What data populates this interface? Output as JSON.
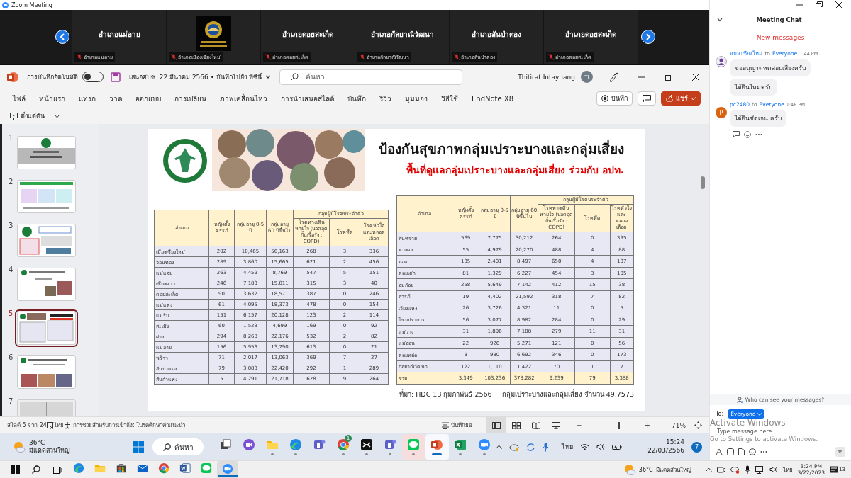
{
  "zoom_window": {
    "title": "Zoom Meeting"
  },
  "video_tiles": [
    {
      "kind": "name",
      "name": "อำเภอแม่อาย",
      "label": "อำเภอแม่อาย",
      "muted": true
    },
    {
      "kind": "picture",
      "label": "อำเภอเมืองเชียงใหม่",
      "muted": true
    },
    {
      "kind": "name",
      "name": "อำเภอดอยสะเก็ด",
      "label": "อำเภอดอยสะเก็ด",
      "muted": true
    },
    {
      "kind": "name",
      "name": "อำเภอกัลยาณิวัฒนา",
      "label": "อำเภอกัลยาณิวัฒนา",
      "muted": true
    },
    {
      "kind": "name",
      "name": "อำเภอสันป่าตอง",
      "label": "อำเภอสันป่าตอง",
      "muted": true
    },
    {
      "kind": "name",
      "name": "อำเภอดอยสะเก็ด",
      "label": "อำเภอดอยสะเก็ด",
      "muted": true
    }
  ],
  "powerpoint": {
    "autosave_label": "การบันทึกอัตโนมัติ",
    "autosave_on": false,
    "file_title": "เสนอศบซ. 22 มีนาคม 2566 • บันทึกไปยัง พีซีนี้",
    "search_placeholder": "ค้นหา",
    "user_name": "Thitirat Intayuang",
    "user_initials": "TI",
    "ribbon_tabs": [
      "ไฟล์",
      "หน้าแรก",
      "แทรก",
      "วาด",
      "ออกแบบ",
      "การเปลี่ยน",
      "ภาพเคลื่อนไหว",
      "การนำเสนอสไลด์",
      "บันทึก",
      "รีวิว",
      "มุมมอง",
      "วิธีใช้",
      "EndNote X8"
    ],
    "record_button": "บันทึก",
    "share_button": "แชร์",
    "start_button": "ตั้งแต่ต้น"
  },
  "thumbnails": [
    {
      "number": "1",
      "selected": false
    },
    {
      "number": "2",
      "selected": false
    },
    {
      "number": "3",
      "selected": false
    },
    {
      "number": "4",
      "selected": false
    },
    {
      "number": "5",
      "selected": true
    },
    {
      "number": "6",
      "selected": false
    },
    {
      "number": "7",
      "selected": false
    }
  ],
  "slide": {
    "title": "ป้องกันสุขภาพกลุ่มเปราะบางและกลุ่มเสี่ยง",
    "subtitle": "พื้นที่ดูแลกลุ่มเปราะบางและกลุ่มเสี่ยง ร่วมกับ อปท.",
    "tables": [
      {
        "columns": [
          "อำเภอ",
          "หญิงตั้งครรภ์",
          "กลุ่มอายุ 0-5 ปี",
          "กลุ่มอายุ 60 ปีขึ้นไป",
          "โรคทางเดินหายใจ (ปอดอุดกั้นเรื้อรัง : COPD)",
          "โรคหืด",
          "โรคหัวใจและหลอดเลือด"
        ],
        "column_group": "กลุ่มผู้มีโรคประจำตัว",
        "rows": [
          [
            "เมืองเชียงใหม่",
            "202",
            "10,465",
            "56,163",
            "268",
            "3",
            "336"
          ],
          [
            "จอมทอง",
            "289",
            "3,860",
            "15,665",
            "621",
            "2",
            "456"
          ],
          [
            "แม่แจ่ม",
            "263",
            "4,459",
            "8,769",
            "547",
            "5",
            "151"
          ],
          [
            "เชียงดาว",
            "246",
            "7,183",
            "15,011",
            "315",
            "3",
            "40"
          ],
          [
            "ดอยสะเก็ด",
            "90",
            "3,632",
            "18,571",
            "387",
            "0",
            "246"
          ],
          [
            "แม่แตง",
            "61",
            "4,095",
            "18,373",
            "478",
            "0",
            "154"
          ],
          [
            "แม่ริม",
            "151",
            "6,157",
            "20,128",
            "123",
            "2",
            "114"
          ],
          [
            "สะเมิง",
            "60",
            "1,523",
            "4,699",
            "169",
            "0",
            "92"
          ],
          [
            "ฝาง",
            "294",
            "8,268",
            "22,176",
            "532",
            "2",
            "82"
          ],
          [
            "แม่อาย",
            "156",
            "5,953",
            "13,790",
            "613",
            "0",
            "21"
          ],
          [
            "พร้าว",
            "71",
            "2,017",
            "13,063",
            "369",
            "7",
            "27"
          ],
          [
            "สันป่าตอง",
            "79",
            "3,083",
            "22,420",
            "292",
            "1",
            "289"
          ],
          [
            "สันกำแพง",
            "5",
            "4,291",
            "21,718",
            "628",
            "9",
            "264"
          ]
        ]
      },
      {
        "columns": [
          "อำเภอ",
          "หญิงตั้งครรภ์",
          "กลุ่มอายุ 0-5 ปี",
          "กลุ่มอายุ 60 ปีขึ้นไป",
          "โรคทางเดินหายใจ (ปอดอุดกั้นเรื้อรัง : COPD)",
          "โรคหืด",
          "โรคหัวใจและหลอดเลือด"
        ],
        "column_group": "กลุ่มผู้มีโรคประจำตัว",
        "rows": [
          [
            "สันทราย",
            "569",
            "7,775",
            "30,212",
            "264",
            "0",
            "395"
          ],
          [
            "หางดง",
            "55",
            "4,979",
            "20,270",
            "488",
            "4",
            "88"
          ],
          [
            "ฮอด",
            "135",
            "2,401",
            "8,497",
            "650",
            "4",
            "107"
          ],
          [
            "ดอยเต่า",
            "81",
            "1,329",
            "6,227",
            "454",
            "3",
            "105"
          ],
          [
            "อมก๋อย",
            "258",
            "5,649",
            "7,142",
            "412",
            "15",
            "38"
          ],
          [
            "สารภี",
            "19",
            "4,402",
            "21,592",
            "318",
            "7",
            "82"
          ],
          [
            "เวียงแหง",
            "26",
            "3,726",
            "4,321",
            "11",
            "0",
            "5"
          ],
          [
            "ไชยปราการ",
            "56",
            "3,077",
            "8,982",
            "284",
            "0",
            "29"
          ],
          [
            "แม่วาง",
            "31",
            "1,896",
            "7,108",
            "279",
            "11",
            "31"
          ],
          [
            "แม่ออน",
            "22",
            "926",
            "5,271",
            "121",
            "0",
            "56"
          ],
          [
            "ดอยหล่อ",
            "8",
            "980",
            "6,692",
            "346",
            "0",
            "173"
          ],
          [
            "กัลยาณิวัฒนา",
            "122",
            "1,110",
            "1,422",
            "70",
            "1",
            "7"
          ]
        ],
        "total": [
          "รวม",
          "3,349",
          "103,236",
          "378,282",
          "9,239",
          "79",
          "3,388"
        ]
      }
    ],
    "source_note": "ที่มา: HDC 13  กุมภาพันธ์ 2566",
    "total_note": "กลุ่มเปราะบางและกลุ่มเสี่ยง จำนวน 49,7573"
  },
  "status_bar": {
    "slide_counter": "สไลด์ 5 จาก 24",
    "language": "ไทย",
    "accessibility": "การช่วยสำหรับการเข้าถึง: โปรดศึกษาคำแนะนำ",
    "notes": "บันทึกย่อ",
    "views": [
      {
        "kind": "normal",
        "selected": true
      },
      {
        "kind": "sorter",
        "selected": false
      },
      {
        "kind": "reading",
        "selected": false
      },
      {
        "kind": "slideshow",
        "selected": false
      }
    ],
    "zoom_out": "−",
    "zoom_in": "+",
    "level": 0.6,
    "zoom_percent": "71%"
  },
  "inner_taskbar": {
    "weather_temp": "36°C",
    "weather_text": "มีแดดส่วนใหญ่",
    "search": "ค้นหา",
    "apps": [
      {
        "kind": "taskview",
        "running": false,
        "active": false,
        "attention": false
      },
      {
        "kind": "meet",
        "running": false,
        "active": false,
        "attention": false
      },
      {
        "kind": "explorer",
        "running": true,
        "active": false,
        "attention": false
      },
      {
        "kind": "edge",
        "running": true,
        "active": false,
        "attention": false
      },
      {
        "kind": "teams",
        "running": false,
        "active": false,
        "attention": false
      },
      {
        "kind": "chrome",
        "running": true,
        "active": false,
        "attention": false,
        "badge": "1"
      },
      {
        "kind": "editor",
        "running": true,
        "active": false,
        "attention": false
      },
      {
        "kind": "teams",
        "running": true,
        "active": false,
        "attention": false
      },
      {
        "kind": "line",
        "running": true,
        "active": false,
        "attention": true
      },
      {
        "kind": "powerpoint",
        "running": true,
        "active": true,
        "attention": false
      },
      {
        "kind": "excel",
        "running": true,
        "active": false,
        "attention": false
      },
      {
        "kind": "zoom",
        "running": true,
        "active": false,
        "attention": false
      }
    ],
    "language": "ไทย",
    "time": "15:24",
    "date": "22/03/2566",
    "notifications": "7"
  },
  "outer_taskbar": {
    "apps": [
      {
        "kind": "edge",
        "active": false
      },
      {
        "kind": "explorer",
        "active": false
      },
      {
        "kind": "store",
        "active": false
      },
      {
        "kind": "mail",
        "active": false
      },
      {
        "kind": "chrome",
        "active": false
      },
      {
        "kind": "word",
        "active": false
      },
      {
        "kind": "line",
        "active": false
      },
      {
        "kind": "zoom",
        "active": true
      }
    ],
    "weather_temp": "36°C",
    "weather_text": "มีแดดส่วนใหญ่",
    "language": "ไทย",
    "time": "3:24 PM",
    "date": "3/22/2023",
    "notifications": "13"
  },
  "chat": {
    "title": "Meeting Chat",
    "new_messages_label": "New messages",
    "messages": [
      {
        "sender": "อบจ.เชียงใหม่",
        "to_word": "to",
        "recipient": "Everyone",
        "time": "1:44 PM",
        "bubbles": [
          "ขออนุญาตทดสอบเสียงครับ",
          "ได้ยินไหมครับ"
        ]
      },
      {
        "avatar_letter": "P",
        "sender": "pc2480",
        "to_word": "to",
        "recipient": "Everyone",
        "time": "1:46 PM",
        "bubbles": [
          "ได้ยินชัดเจน ครับ"
        ]
      }
    ],
    "privacy_note": "Who can see your messages?",
    "to_label": "To:",
    "recipient_button": "Everyone",
    "input_placeholder": "Type message here..."
  },
  "activation_notice": {
    "title": "Activate Windows",
    "detail": "Go to Settings to activate Windows."
  }
}
